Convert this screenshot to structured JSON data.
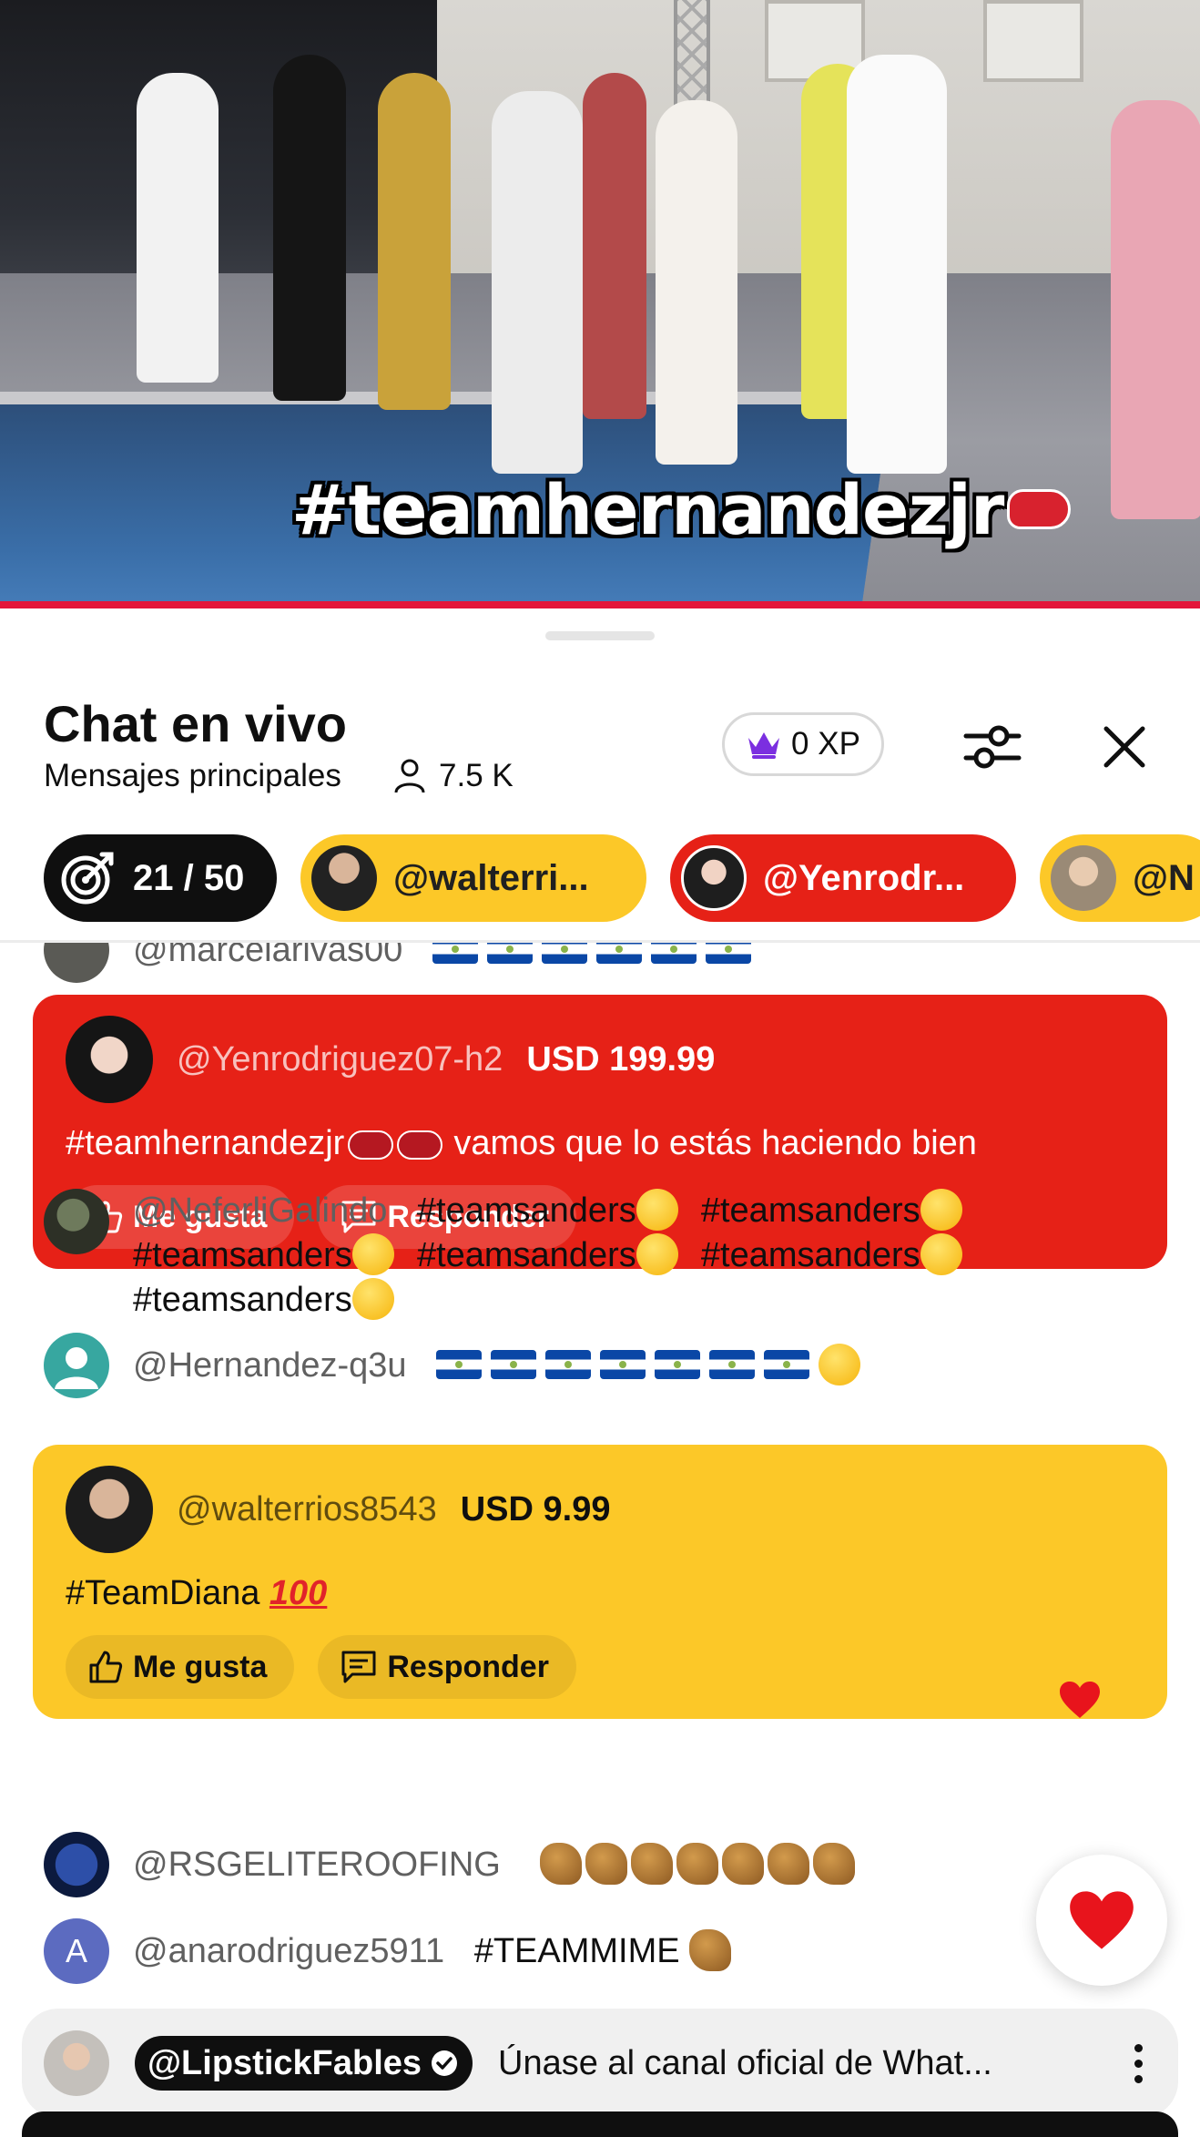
{
  "video": {
    "caption": "#teamhernandezjr",
    "progress_color": "#e3163a"
  },
  "header": {
    "title": "Chat en vivo",
    "subtitle": "Mensajes principales",
    "viewer_count": "7.5 K",
    "xp_label": "0 XP"
  },
  "chips": [
    {
      "label": "21 / 50",
      "type": "goal"
    },
    {
      "label": "@walterri...",
      "color": "#fcc828"
    },
    {
      "label": "@Yenrodr...",
      "color": "#e62117"
    },
    {
      "label": "@N",
      "color": "#fcc828"
    }
  ],
  "messages": {
    "partial": {
      "author": "@marcelarivas00"
    },
    "superchat1": {
      "author": "@Yenrodriguez07-h2",
      "amount": "USD 199.99",
      "text_before": "#teamhernandezjr",
      "text_after": "vamos que lo estás haciendo bien",
      "like_label": "Me gusta",
      "reply_label": "Responder"
    },
    "msg1": {
      "author": "@NeferliGalindo",
      "tag": "#teamsanders"
    },
    "msg2": {
      "author": "@Hernandez-q3u"
    },
    "superchat2": {
      "author": "@walterrios8543",
      "amount": "USD 9.99",
      "text": "#TeamDiana",
      "emoji_text": "100",
      "like_label": "Me gusta",
      "reply_label": "Responder"
    },
    "msg3": {
      "author": "@RSGELITEROOFING"
    },
    "msg4": {
      "author": "@anarodriguez5911",
      "avatar_letter": "A",
      "text": "#TEAMMIME"
    }
  },
  "pinned": {
    "channel": "@LipstickFables",
    "text": "Únase al canal oficial de What..."
  },
  "colors": {
    "superchat_red": "#e62117",
    "superchat_yellow": "#fcc828",
    "heart": "#e8141c"
  }
}
